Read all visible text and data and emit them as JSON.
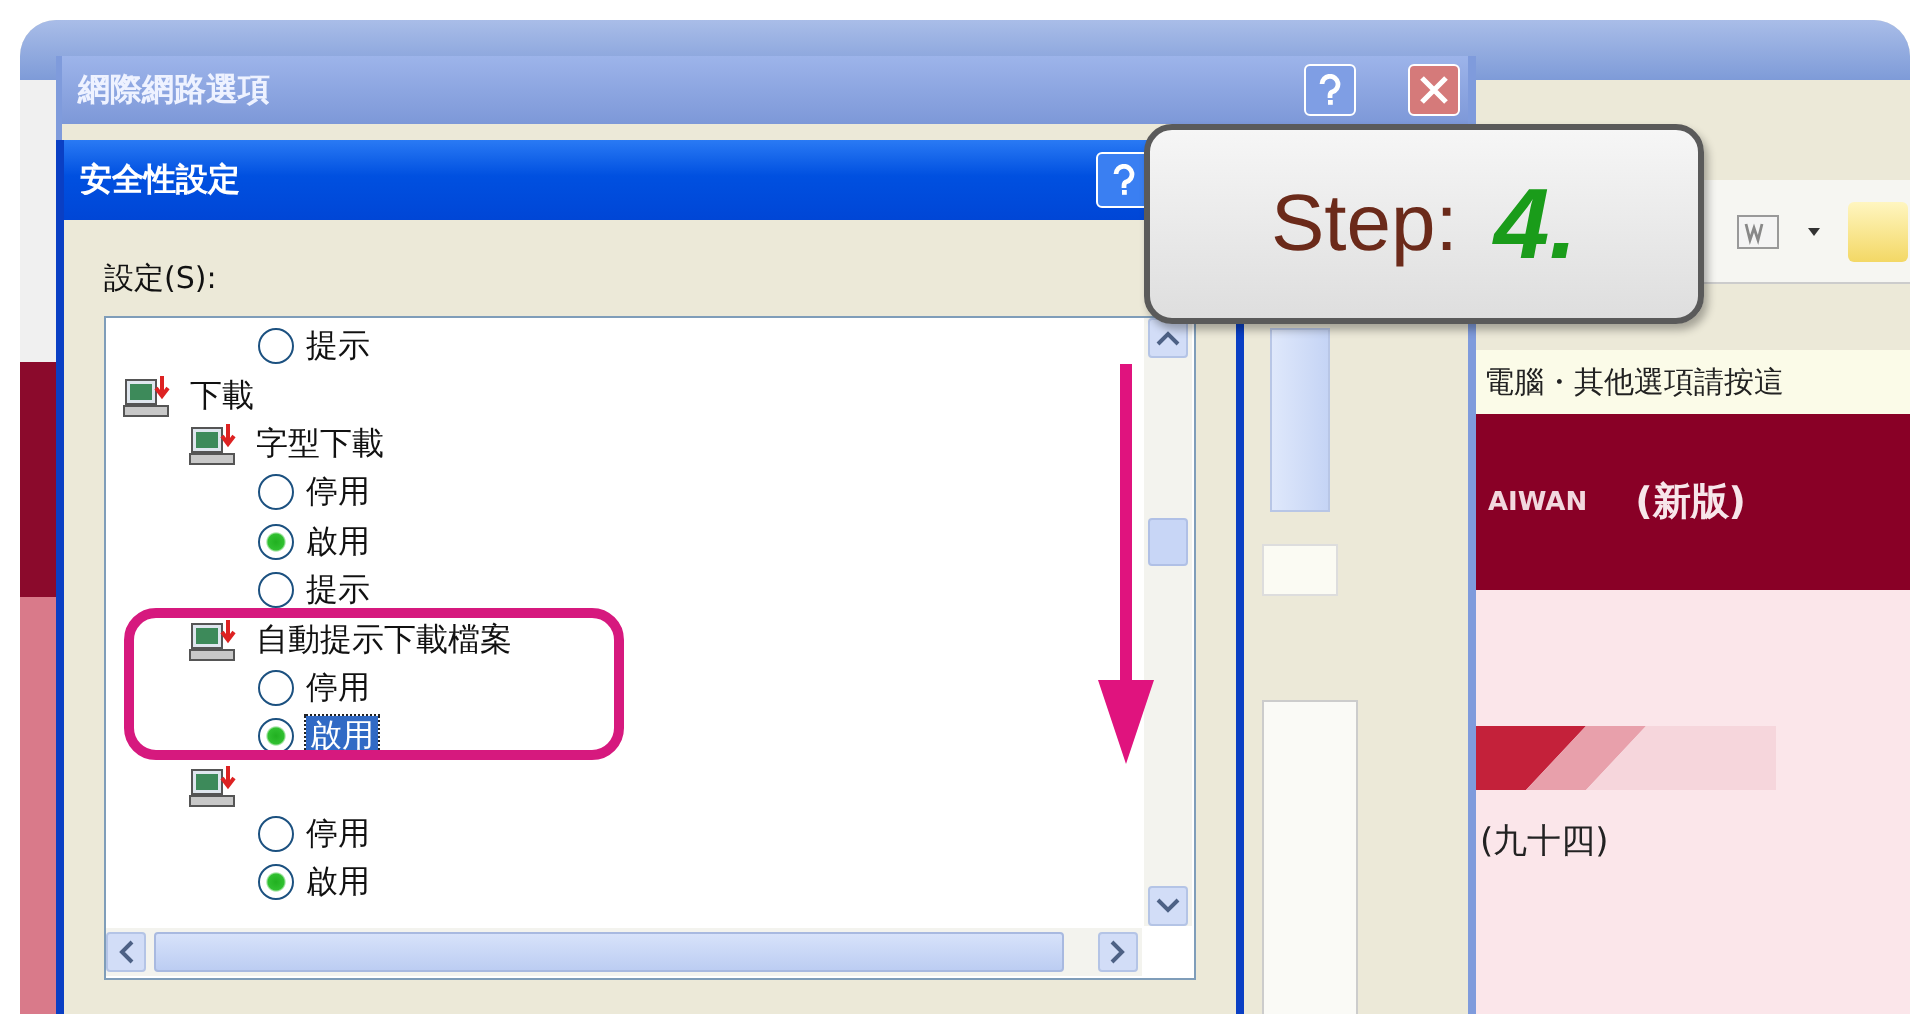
{
  "browser_window": {
    "notice_text": "電腦・其他選項請按這",
    "banner_text": "AIWAN",
    "banner_subtitle": "(新版)",
    "year_text": "(九十四)"
  },
  "options_dialog": {
    "title": "網際網路選項"
  },
  "security_dialog": {
    "title": "安全性設定",
    "settings_label": "設定(S):",
    "tree": [
      {
        "kind": "continued",
        "children": [
          {
            "kind": "continued",
            "children": [
              {
                "kind": "radio",
                "label": "提示",
                "selected": false,
                "focused": false
              }
            ]
          }
        ]
      },
      {
        "kind": "group",
        "label": "下載",
        "children": [
          {
            "kind": "group",
            "label": "字型下載",
            "children": [
              {
                "kind": "radio",
                "label": "停用",
                "selected": false,
                "focused": false
              },
              {
                "kind": "radio",
                "label": "啟用",
                "selected": true,
                "focused": false
              },
              {
                "kind": "radio",
                "label": "提示",
                "selected": false,
                "focused": false
              }
            ]
          },
          {
            "kind": "group",
            "label": "自動提示下載檔案",
            "children": [
              {
                "kind": "radio",
                "label": "停用",
                "selected": false,
                "focused": false
              },
              {
                "kind": "radio",
                "label": "啟用",
                "selected": true,
                "focused": true
              }
            ]
          },
          {
            "kind": "group",
            "children": [
              {
                "kind": "radio",
                "label": "停用",
                "selected": false,
                "focused": false
              },
              {
                "kind": "radio",
                "label": "啟用",
                "selected": true,
                "focused": false
              }
            ]
          }
        ]
      }
    ]
  },
  "callout": {
    "label": "Step:",
    "number": "4."
  }
}
